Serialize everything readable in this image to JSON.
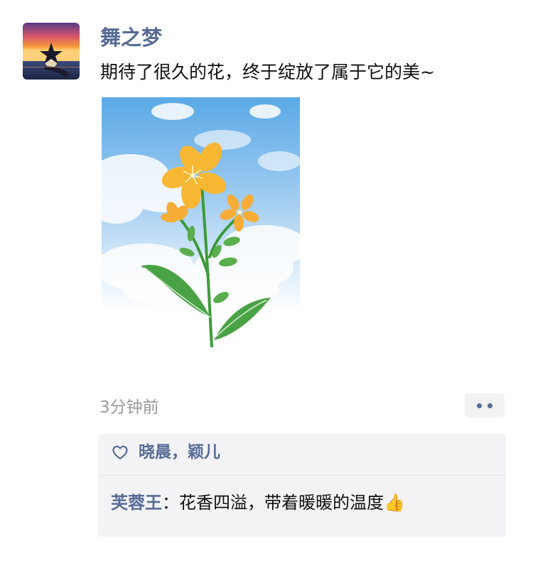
{
  "post": {
    "author": "舞之梦",
    "text": "期待了很久的花，终于绽放了属于它的美~",
    "timestamp": "3分钟前"
  },
  "likes": {
    "names": "晓晨，颖儿"
  },
  "comment": {
    "author": "芙蓉王",
    "separator": "：",
    "text": "花香四溢，带着暖暖的温度👍"
  },
  "colors": {
    "link": "#576b95",
    "timestamp": "#9a9a9a",
    "panel_bg": "#f3f3f5"
  }
}
